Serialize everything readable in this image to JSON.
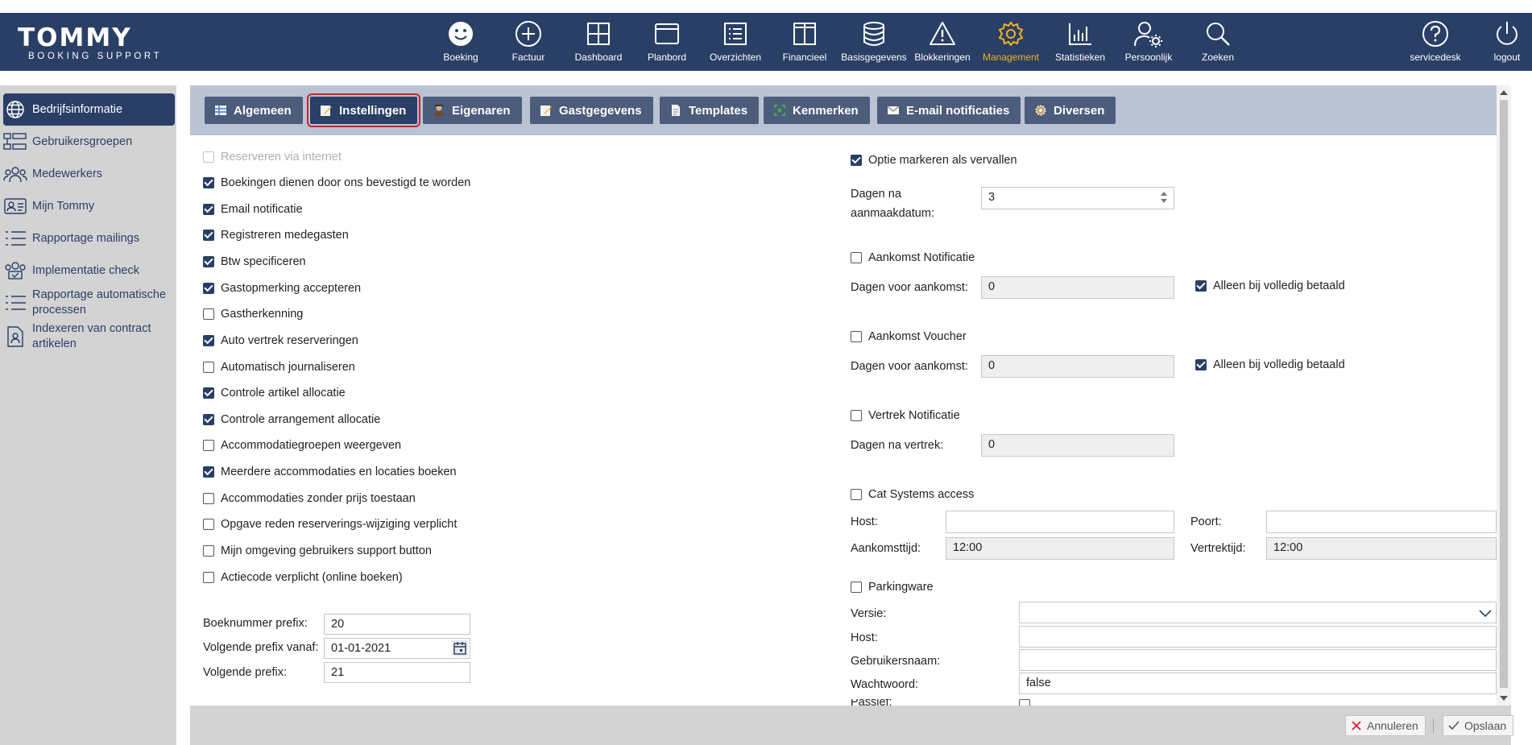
{
  "app": {
    "logo_main": "TOMMY",
    "logo_sub": "BOOKING SUPPORT"
  },
  "nav": [
    {
      "label": "Boeking",
      "icon": "smiley-icon"
    },
    {
      "label": "Factuur",
      "icon": "plus-circle-icon"
    },
    {
      "label": "Dashboard",
      "icon": "grid-icon"
    },
    {
      "label": "Planbord",
      "icon": "board-icon"
    },
    {
      "label": "Overzichten",
      "icon": "list-icon"
    },
    {
      "label": "Financieel",
      "icon": "columns-icon"
    },
    {
      "label": "Basisgegevens",
      "icon": "database-icon"
    },
    {
      "label": "Blokkeringen",
      "icon": "warning-icon"
    },
    {
      "label": "Management",
      "icon": "gear-icon",
      "active": true
    },
    {
      "label": "Statistieken",
      "icon": "bar-chart-icon"
    },
    {
      "label": "Persoonlijk",
      "icon": "user-gear-icon"
    },
    {
      "label": "Zoeken",
      "icon": "search-icon"
    },
    {
      "label": "servicedesk",
      "icon": "help-icon"
    },
    {
      "label": "logout",
      "icon": "power-icon"
    }
  ],
  "sidebar": {
    "items": [
      {
        "label": "Bedrijfsinformatie",
        "icon": "globe-icon",
        "active": true
      },
      {
        "label": "Gebruikersgroepen",
        "icon": "groups-icon"
      },
      {
        "label": "Medewerkers",
        "icon": "people-icon"
      },
      {
        "label": "Mijn Tommy",
        "icon": "id-card-icon"
      },
      {
        "label": "Rapportage mailings",
        "icon": "list-lines-icon"
      },
      {
        "label": "Implementatie check",
        "icon": "people-check-icon"
      },
      {
        "label": "Rapportage automatische processen",
        "icon": "list-lines-icon"
      },
      {
        "label": "Indexeren van contract artikelen",
        "icon": "document-user-icon"
      }
    ]
  },
  "tabs": [
    {
      "label": "Algemeen",
      "icon": "table-icon"
    },
    {
      "label": "Instellingen",
      "icon": "edit-icon",
      "active": true
    },
    {
      "label": "Eigenaren",
      "icon": "owner-icon"
    },
    {
      "label": "Gastgegevens",
      "icon": "edit-icon"
    },
    {
      "label": "Templates",
      "icon": "page-icon"
    },
    {
      "label": "Kenmerken",
      "icon": "features-icon"
    },
    {
      "label": "E-mail notificaties",
      "icon": "envelope-icon"
    },
    {
      "label": "Diversen",
      "icon": "cog-icon"
    }
  ],
  "settings": [
    {
      "label": "Reserveren via internet",
      "checked": false,
      "disabled": true
    },
    {
      "label": "Boekingen dienen door ons bevestigd te worden",
      "checked": true
    },
    {
      "label": "Email notificatie",
      "checked": true
    },
    {
      "label": "Registreren medegasten",
      "checked": true
    },
    {
      "label": "Btw specificeren",
      "checked": true
    },
    {
      "label": "Gastopmerking accepteren",
      "checked": true
    },
    {
      "label": "Gastherkenning",
      "checked": false
    },
    {
      "label": "Auto vertrek reserveringen",
      "checked": true
    },
    {
      "label": "Automatisch journaliseren",
      "checked": false
    },
    {
      "label": "Controle artikel allocatie",
      "checked": true
    },
    {
      "label": "Controle arrangement allocatie",
      "checked": true
    },
    {
      "label": "Accommodatiegroepen weergeven",
      "checked": false
    },
    {
      "label": "Meerdere accommodaties en locaties boeken",
      "checked": true
    },
    {
      "label": "Accommodaties zonder prijs toestaan",
      "checked": false
    },
    {
      "label": "Opgave reden reserverings-wijziging verplicht",
      "checked": false
    },
    {
      "label": "Mijn omgeving gebruikers support button",
      "checked": false
    },
    {
      "label": "Actiecode verplicht (online boeken)",
      "checked": false
    }
  ],
  "prefix": {
    "boeknummer_label": "Boeknummer prefix:",
    "boeknummer_value": "20",
    "vanaf_label": "Volgende prefix vanaf:",
    "vanaf_value": "01-01-2021",
    "volgende_label": "Volgende prefix:",
    "volgende_value": "21"
  },
  "right": {
    "optie": {
      "label": "Optie markeren als vervallen",
      "checked": true
    },
    "dagen_na_aanmaak_label_1": "Dagen na",
    "dagen_na_aanmaak_label_2": "aanmaakdatum:",
    "dagen_na_aanmaak_value": "3",
    "aankomst_notificatie": {
      "label": "Aankomst Notificatie",
      "checked": false
    },
    "an_dagen_label": "Dagen voor aankomst:",
    "an_dagen_value": "0",
    "an_betaald": {
      "label": "Alleen bij volledig betaald",
      "checked": true
    },
    "aankomst_voucher": {
      "label": "Aankomst Voucher",
      "checked": false
    },
    "av_dagen_label": "Dagen voor aankomst:",
    "av_dagen_value": "0",
    "av_betaald": {
      "label": "Alleen bij volledig betaald",
      "checked": true
    },
    "vertrek_notificatie": {
      "label": "Vertrek Notificatie",
      "checked": false
    },
    "vn_dagen_label": "Dagen na vertrek:",
    "vn_dagen_value": "0",
    "cat": {
      "label": "Cat Systems access",
      "checked": false
    },
    "cat_host_label": "Host:",
    "cat_host_value": "",
    "cat_poort_label": "Poort:",
    "cat_poort_value": "",
    "cat_aankomst_label": "Aankomsttijd:",
    "cat_aankomst_value": "12:00",
    "cat_vertrek_label": "Vertrektijd:",
    "cat_vertrek_value": "12:00",
    "parking": {
      "label": "Parkingware",
      "checked": false
    },
    "pw_versie_label": "Versie:",
    "pw_versie_value": "",
    "pw_host_label": "Host:",
    "pw_host_value": "",
    "pw_user_label": "Gebruikersnaam:",
    "pw_user_value": "",
    "pw_pass_label": "Wachtwoord:",
    "pw_pass_value": "false",
    "pw_passief_label": "Passief:",
    "pw_passief_checked": false
  },
  "footer": {
    "cancel_label": "Annuleren",
    "save_label": "Opslaan"
  }
}
